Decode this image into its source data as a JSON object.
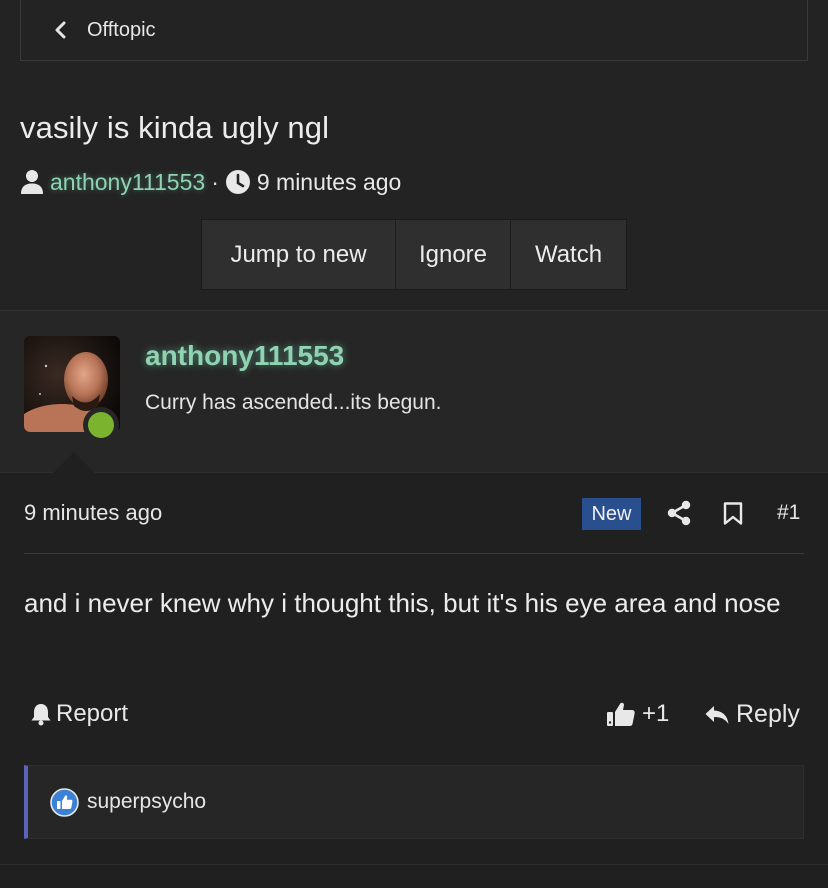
{
  "breadcrumb": {
    "label": "Offtopic"
  },
  "thread": {
    "title": "vasily is kinda ugly ngl",
    "author": "anthony111553",
    "separator": "·",
    "time": "9 minutes ago"
  },
  "actions": {
    "jump": "Jump to new",
    "ignore": "Ignore",
    "watch": "Watch"
  },
  "post": {
    "username": "anthony111553",
    "user_title": "Curry has ascended...its begun.",
    "online": true,
    "time": "9 minutes ago",
    "badge": "New",
    "number": "#1",
    "body": "and i never knew why i thought this, but it's his eye area and nose",
    "report": "Report",
    "like_count": "+1",
    "reply": "Reply",
    "reactions": {
      "user": "superpsycho"
    }
  },
  "colors": {
    "background": "#232323",
    "username_green": "#8fd3b3",
    "new_badge": "#2a4f8f",
    "online": "#7cb32e",
    "reaction_bar": "#5b63b8"
  }
}
